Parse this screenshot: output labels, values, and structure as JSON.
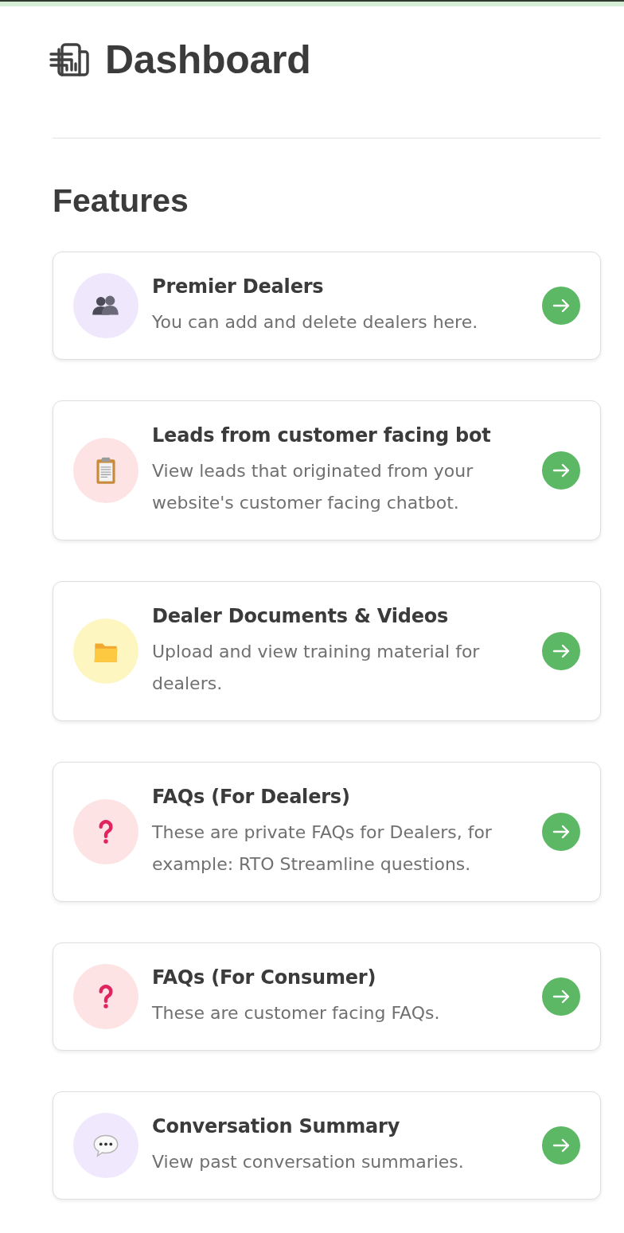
{
  "header": {
    "title": "Dashboard"
  },
  "section": {
    "title": "Features"
  },
  "features": [
    {
      "kind": "people",
      "color": "#efe7fc",
      "title": "Premier Dealers",
      "description": "You can add and delete dealers here."
    },
    {
      "kind": "clipboard",
      "color": "#fde3e3",
      "title": "Leads from customer facing bot",
      "description": "View leads that originated from your website's customer facing chatbot."
    },
    {
      "kind": "folder",
      "color": "#fef6c0",
      "title": "Dealer Documents & Videos",
      "description": "Upload and view training material for dealers."
    },
    {
      "kind": "question",
      "color": "#fde3e3",
      "title": "FAQs (For Dealers)",
      "description": "These are private FAQs for Dealers, for example: RTO Streamline questions."
    },
    {
      "kind": "question",
      "color": "#fde3e3",
      "title": "FAQs (For Consumer)",
      "description": "These are customer facing FAQs."
    },
    {
      "kind": "speech",
      "color": "#f0e8fc",
      "title": "Conversation Summary",
      "description": "View past conversation summaries."
    }
  ]
}
